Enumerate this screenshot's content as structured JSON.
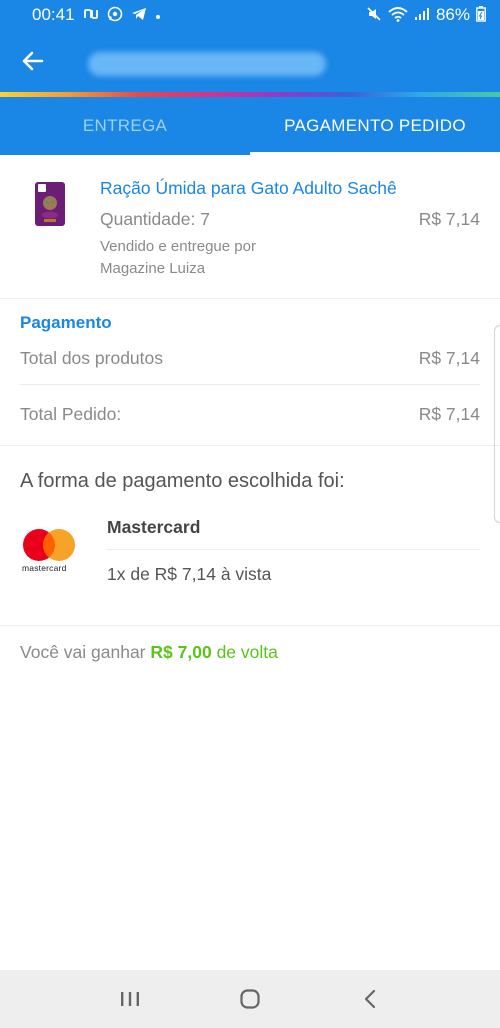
{
  "status_bar": {
    "time": "00:41",
    "battery": "86%",
    "left_icons": [
      "nu-icon",
      "whatsapp-icon",
      "telegram-icon",
      "dot-icon"
    ],
    "right_icons": [
      "mute-icon",
      "wifi-icon",
      "signal-icon",
      "battery-icon"
    ]
  },
  "app_bar": {
    "title_obscured": true
  },
  "tabs": [
    {
      "label": "ENTREGA",
      "active": false
    },
    {
      "label": "PAGAMENTO PEDIDO",
      "active": true
    }
  ],
  "product": {
    "name": "Ração Úmida para Gato Adulto Sachê",
    "quantity_label": "Quantidade: 7",
    "price": "R$ 7,14",
    "sold_by_label": "Vendido e entregue por",
    "seller": "Magazine Luiza"
  },
  "payment_summary": {
    "section_title": "Pagamento",
    "products_total_label": "Total dos produtos",
    "products_total_value": "R$ 7,14",
    "order_total_label": "Total Pedido:",
    "order_total_value": "R$ 7,14"
  },
  "payment_method": {
    "heading": "A forma de pagamento escolhida foi:",
    "card_name": "Mastercard",
    "logo_text": "mastercard",
    "installments": "1x de R$ 7,14 à vista"
  },
  "cashback": {
    "prefix": "Você vai ganhar",
    "amount": "R$ 7,00",
    "suffix": "de volta"
  },
  "colors": {
    "primary": "#1a86e6",
    "cashback_green": "#5bc41a",
    "mastercard_red": "#eb001b",
    "mastercard_orange": "#f79e1b"
  }
}
